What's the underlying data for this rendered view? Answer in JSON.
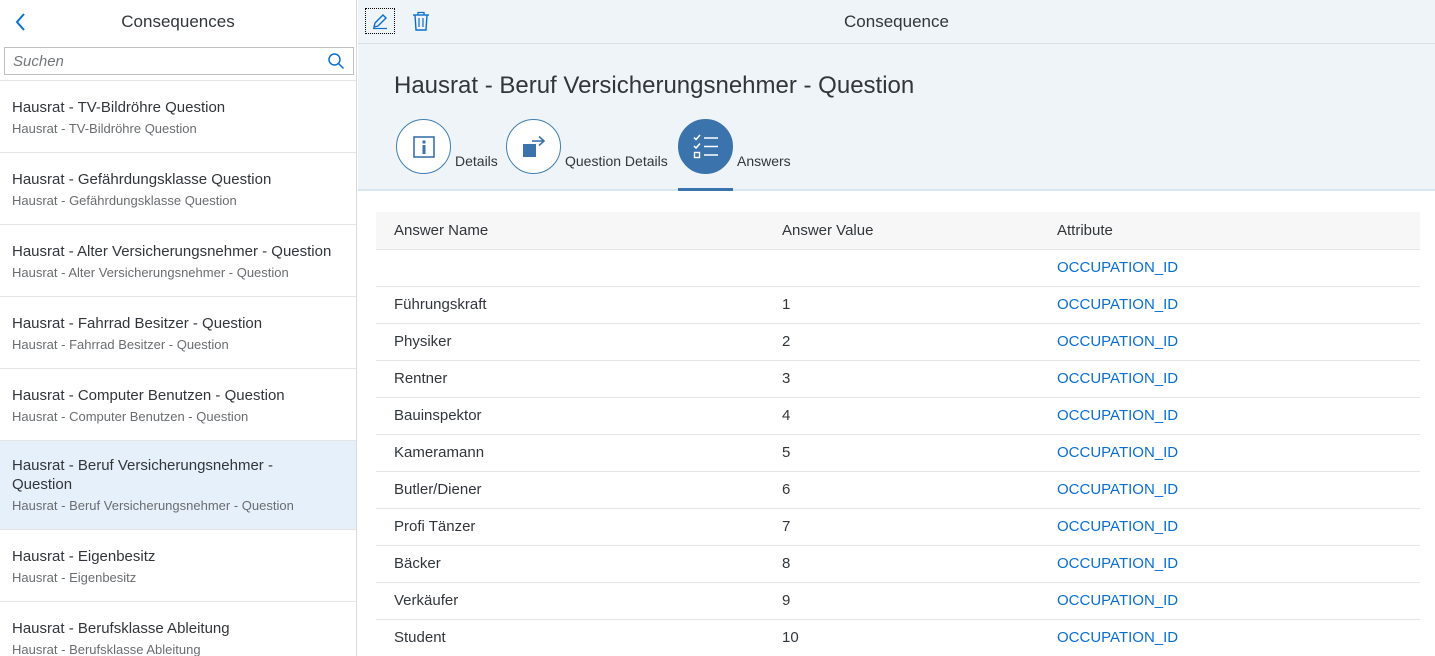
{
  "master": {
    "title": "Consequences",
    "search_placeholder": "Suchen",
    "items": [
      {
        "title": "Hausrat - TV-Bildröhre Question",
        "description": "Hausrat - TV-Bildröhre Question"
      },
      {
        "title": "Hausrat - Gefährdungsklasse Question",
        "description": "Hausrat - Gefährdungsklasse Question"
      },
      {
        "title": "Hausrat - Alter Versicherungsnehmer - Question",
        "description": "Hausrat - Alter Versicherungsnehmer - Question"
      },
      {
        "title": "Hausrat - Fahrrad Besitzer - Question",
        "description": "Hausrat - Fahrrad Besitzer - Question"
      },
      {
        "title": "Hausrat - Computer Benutzen - Question",
        "description": "Hausrat - Computer Benutzen - Question"
      },
      {
        "title_line1": "Hausrat - Beruf Versicherungsnehmer -",
        "title_line2": "Question",
        "description": "Hausrat - Beruf Versicherungsnehmer - Question",
        "selected": true
      },
      {
        "title": "Hausrat - Eigenbesitz",
        "description": "Hausrat - Eigenbesitz"
      },
      {
        "title": "Hausrat - Berufsklasse Ableitung",
        "description": "Hausrat - Berufsklasse Ableitung"
      }
    ]
  },
  "detail": {
    "toolbar_title": "Consequence",
    "object_title": "Hausrat - Beruf Versicherungsnehmer - Question",
    "tabs": [
      {
        "label": "Details",
        "icon": "info-icon"
      },
      {
        "label": "Question Details",
        "icon": "export-icon"
      },
      {
        "label": "Answers",
        "icon": "checklist-icon",
        "active": true
      }
    ]
  },
  "answers_table": {
    "columns": [
      "Answer Name",
      "Answer Value",
      "Attribute"
    ],
    "rows": [
      {
        "name": "",
        "value": "",
        "attribute": "OCCUPATION_ID"
      },
      {
        "name": "Führungskraft",
        "value": "1",
        "attribute": "OCCUPATION_ID"
      },
      {
        "name": "Physiker",
        "value": "2",
        "attribute": "OCCUPATION_ID"
      },
      {
        "name": "Rentner",
        "value": "3",
        "attribute": "OCCUPATION_ID"
      },
      {
        "name": "Bauinspektor",
        "value": "4",
        "attribute": "OCCUPATION_ID"
      },
      {
        "name": "Kameramann",
        "value": "5",
        "attribute": "OCCUPATION_ID"
      },
      {
        "name": "Butler/Diener",
        "value": "6",
        "attribute": "OCCUPATION_ID"
      },
      {
        "name": "Profi Tänzer",
        "value": "7",
        "attribute": "OCCUPATION_ID"
      },
      {
        "name": "Bäcker",
        "value": "8",
        "attribute": "OCCUPATION_ID"
      },
      {
        "name": "Verkäufer",
        "value": "9",
        "attribute": "OCCUPATION_ID"
      },
      {
        "name": "Student",
        "value": "10",
        "attribute": "OCCUPATION_ID"
      }
    ]
  },
  "colors": {
    "accent": "#3b73ad",
    "link": "#0a6ed1",
    "header_bg": "#eff4f9",
    "selected_bg": "#e5f0fa"
  }
}
